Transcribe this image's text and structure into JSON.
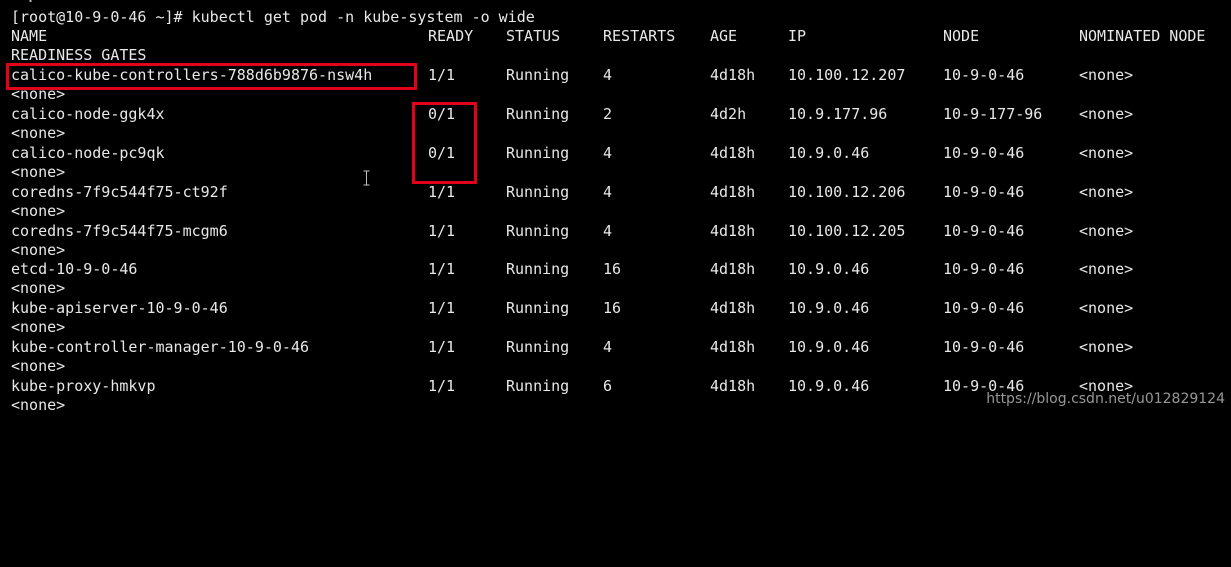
{
  "terminal": {
    "clipped_top_text": "  .  ",
    "prompt": "[root@10-9-0-46 ~]# kubectl get pod -n kube-system -o wide",
    "headers": {
      "name": "NAME",
      "ready": "READY",
      "status": "STATUS",
      "restarts": "RESTARTS",
      "age": "AGE",
      "ip": "IP",
      "node": "NODE",
      "nominated": "NOMINATED NODE",
      "readiness": "READINESS GATES"
    },
    "rows": [
      {
        "name": "calico-kube-controllers-788d6b9876-nsw4h",
        "ready": "1/1",
        "status": "Running",
        "restarts": "4",
        "age": "4d18h",
        "ip": "10.100.12.207",
        "node": "10-9-0-46",
        "nominated": "<none>",
        "readiness": "<none>"
      },
      {
        "name": "calico-node-ggk4x",
        "ready": "0/1",
        "status": "Running",
        "restarts": "2",
        "age": "4d2h",
        "ip": "10.9.177.96",
        "node": "10-9-177-96",
        "nominated": "<none>",
        "readiness": "<none>"
      },
      {
        "name": "calico-node-pc9qk",
        "ready": "0/1",
        "status": "Running",
        "restarts": "4",
        "age": "4d18h",
        "ip": "10.9.0.46",
        "node": "10-9-0-46",
        "nominated": "<none>",
        "readiness": "<none>"
      },
      {
        "name": "coredns-7f9c544f75-ct92f",
        "ready": "1/1",
        "status": "Running",
        "restarts": "4",
        "age": "4d18h",
        "ip": "10.100.12.206",
        "node": "10-9-0-46",
        "nominated": "<none>",
        "readiness": "<none>"
      },
      {
        "name": "coredns-7f9c544f75-mcgm6",
        "ready": "1/1",
        "status": "Running",
        "restarts": "4",
        "age": "4d18h",
        "ip": "10.100.12.205",
        "node": "10-9-0-46",
        "nominated": "<none>",
        "readiness": "<none>"
      },
      {
        "name": "etcd-10-9-0-46",
        "ready": "1/1",
        "status": "Running",
        "restarts": "16",
        "age": "4d18h",
        "ip": "10.9.0.46",
        "node": "10-9-0-46",
        "nominated": "<none>",
        "readiness": "<none>"
      },
      {
        "name": "kube-apiserver-10-9-0-46",
        "ready": "1/1",
        "status": "Running",
        "restarts": "16",
        "age": "4d18h",
        "ip": "10.9.0.46",
        "node": "10-9-0-46",
        "nominated": "<none>",
        "readiness": "<none>"
      },
      {
        "name": "kube-controller-manager-10-9-0-46",
        "ready": "1/1",
        "status": "Running",
        "restarts": "4",
        "age": "4d18h",
        "ip": "10.9.0.46",
        "node": "10-9-0-46",
        "nominated": "<none>",
        "readiness": "<none>"
      },
      {
        "name": "kube-proxy-hmkvp",
        "ready": "1/1",
        "status": "Running",
        "restarts": "6",
        "age": "4d18h",
        "ip": "10.9.0.46",
        "node": "10-9-0-46",
        "nominated": "<none>",
        "readiness": "<none>"
      }
    ]
  },
  "watermark": "https://blog.csdn.net/u012829124",
  "colors": {
    "background": "#000000",
    "text": "#e8e8e8",
    "annotation_red": "#e3001b"
  }
}
